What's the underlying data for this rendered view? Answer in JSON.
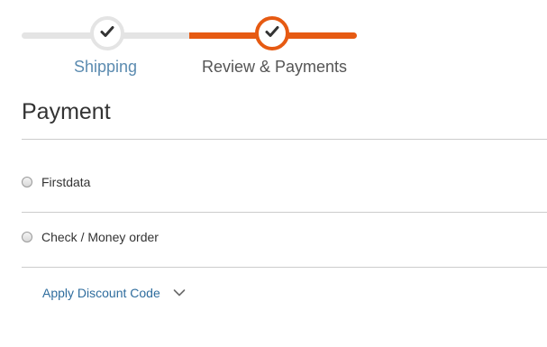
{
  "progress": {
    "steps": [
      {
        "label": "Shipping",
        "state": "complete"
      },
      {
        "label": "Review & Payments",
        "state": "active"
      }
    ],
    "colors": {
      "inactive": "#e4e4e4",
      "active": "#e65a12"
    }
  },
  "payment": {
    "title": "Payment",
    "methods": [
      {
        "label": "Firstdata",
        "selected": false
      },
      {
        "label": "Check / Money order",
        "selected": false
      }
    ]
  },
  "discount": {
    "label": "Apply Discount Code",
    "icon": "chevron-down-icon"
  }
}
